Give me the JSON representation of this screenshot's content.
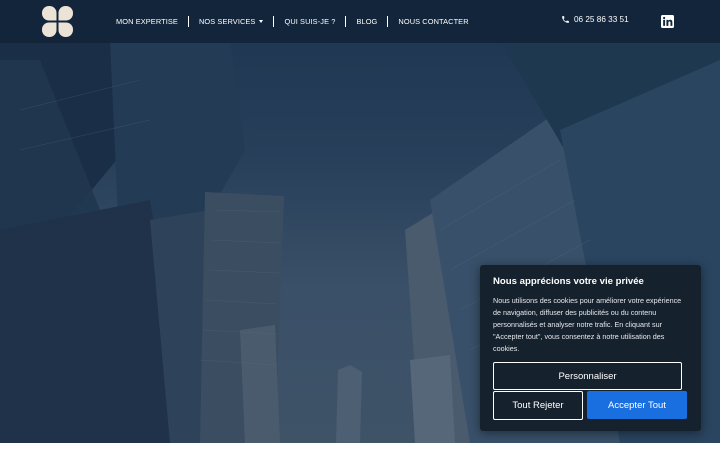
{
  "header": {
    "nav": [
      {
        "label": "MON EXPERTISE",
        "dropdown": false
      },
      {
        "label": "NOS SERVICES",
        "dropdown": true
      },
      {
        "label": "QUI SUIS-JE ?",
        "dropdown": false
      },
      {
        "label": "BLOG",
        "dropdown": false
      },
      {
        "label": "NOUS CONTACTER",
        "dropdown": false
      }
    ],
    "phone": "06 25 86 33 51",
    "social_icon": "linkedin-icon"
  },
  "cookie": {
    "title": "Nous apprécions votre vie privée",
    "text": "Nous utilisons des cookies pour améliorer votre expérience de navigation, diffuser des publicités ou du contenu personnalisés et analyser notre trafic. En cliquant sur \"Accepter tout\", vous consentez à notre utilisation des cookies.",
    "customize_label": "Personnaliser",
    "reject_label": "Tout Rejeter",
    "accept_label": "Accepter Tout"
  },
  "colors": {
    "accent": "#1a6fe0",
    "header_bg": "#122438",
    "modal_bg": "#16212e"
  }
}
